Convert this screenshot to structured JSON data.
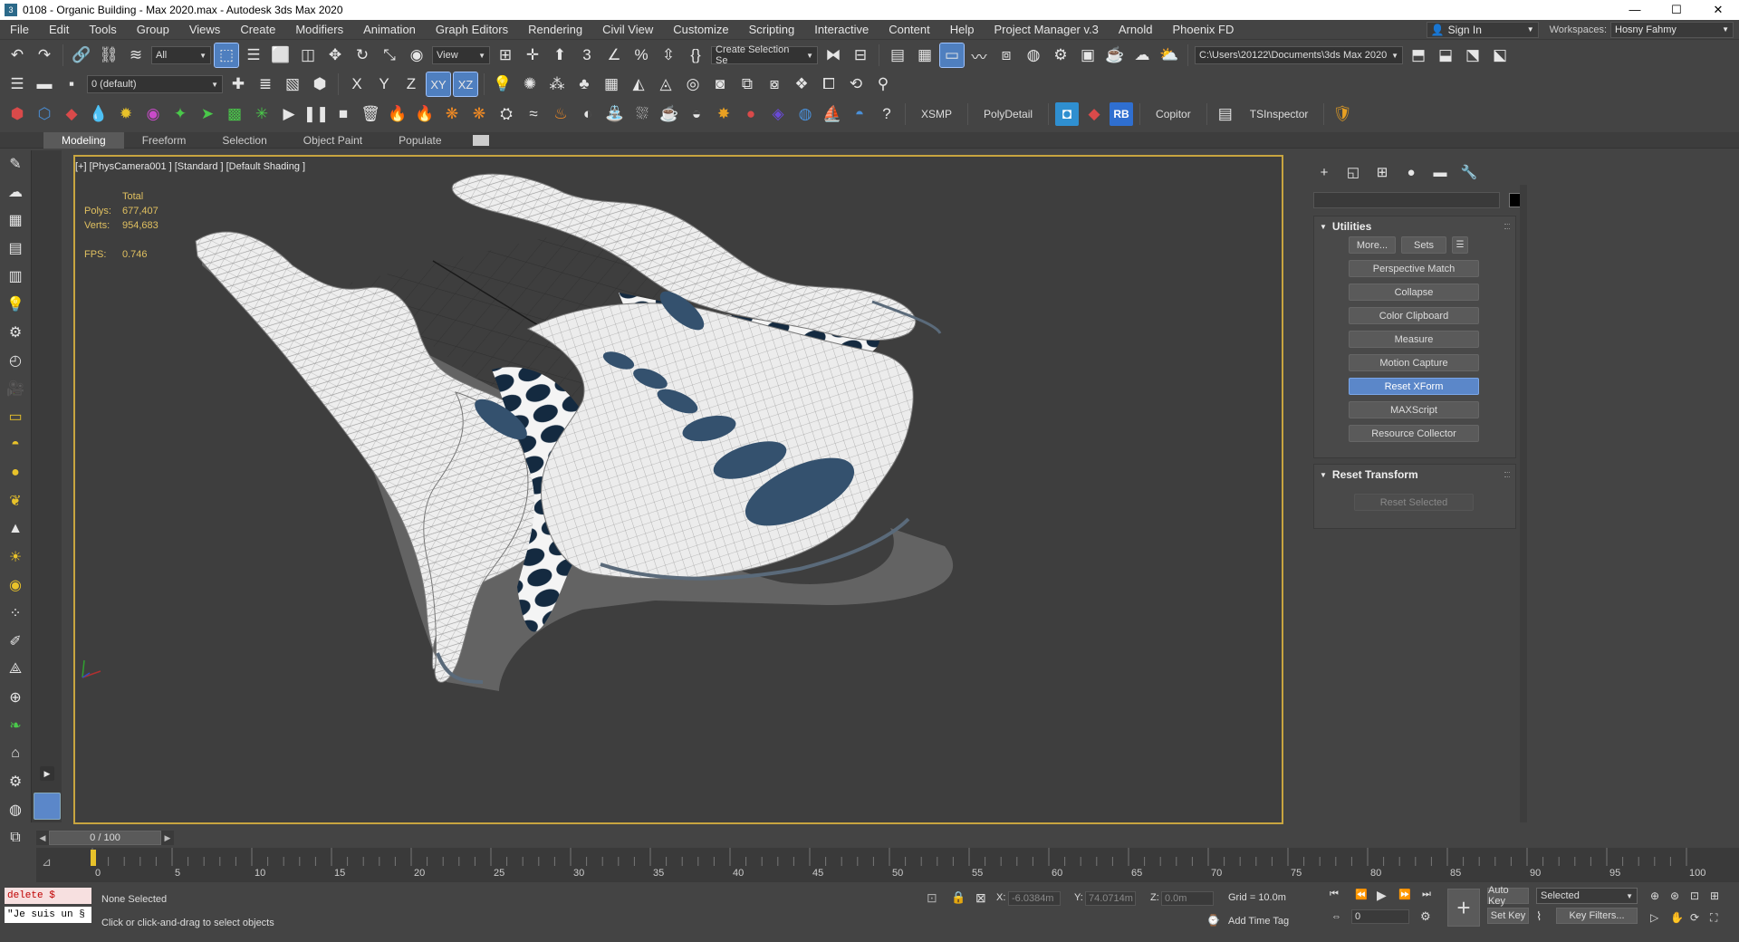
{
  "window": {
    "title": "0108 - Organic Building - Max 2020.max - Autodesk 3ds Max 2020",
    "controls": {
      "minimize": "—",
      "maximize": "☐",
      "close": "✕"
    }
  },
  "menu": [
    "File",
    "Edit",
    "Tools",
    "Group",
    "Views",
    "Create",
    "Modifiers",
    "Animation",
    "Graph Editors",
    "Rendering",
    "Civil View",
    "Customize",
    "Scripting",
    "Interactive",
    "Content",
    "Help",
    "Project Manager v.3",
    "Arnold",
    "Phoenix FD"
  ],
  "account": {
    "sign_in": "Sign In",
    "workspaces_label": "Workspaces:",
    "workspace": "Hosny Fahmy"
  },
  "toolbar1": {
    "selection_filter": "All",
    "ref_coord": "View",
    "named_selection": "Create Selection Se",
    "project_path": "C:\\Users\\20122\\Documents\\3ds Max 2020"
  },
  "toolbar2": {
    "layer": "0 (default)",
    "axis": {
      "x": "X",
      "y": "Y",
      "z": "Z",
      "xy": "XY",
      "xz": "XZ"
    }
  },
  "toolbar3": {
    "xsmp": "XSMP",
    "polydetail": "PolyDetail",
    "rb": "RB",
    "copitor": "Copitor",
    "tsinspector": "TSInspector"
  },
  "ribbon": {
    "tabs": [
      "Modeling",
      "Freeform",
      "Selection",
      "Object Paint",
      "Populate"
    ],
    "active": "Modeling"
  },
  "viewport": {
    "label": "[+] [PhysCamera001 ] [Standard ] [Default Shading ]",
    "stats": {
      "header": "Total",
      "polys_label": "Polys:",
      "polys": "677,407",
      "verts_label": "Verts:",
      "verts": "954,683",
      "fps_label": "FPS:",
      "fps": "0.746"
    }
  },
  "command_panel": {
    "utilities": {
      "title": "Utilities",
      "more": "More...",
      "sets": "Sets",
      "buttons": [
        "Perspective Match",
        "Collapse",
        "Color Clipboard",
        "Measure",
        "Motion Capture",
        "Reset XForm",
        "MAXScript",
        "Resource Collector"
      ],
      "active_button": "Reset XForm"
    },
    "reset_transform": {
      "title": "Reset Transform",
      "reset_selected": "Reset Selected"
    }
  },
  "timeline": {
    "frame": "0 / 100",
    "ticks": [
      "0",
      "5",
      "10",
      "15",
      "20",
      "25",
      "30",
      "35",
      "40",
      "45",
      "50",
      "55",
      "60",
      "65",
      "70",
      "75",
      "80",
      "85",
      "90",
      "95",
      "100"
    ]
  },
  "status": {
    "maxscript_line1": "delete $",
    "maxscript_line2": "\"Je suis un §",
    "selection": "None Selected",
    "prompt": "Click or click-and-drag to select objects",
    "x_label": "X:",
    "x": "-6.0384m",
    "y_label": "Y:",
    "y": "74.0714m",
    "z_label": "Z:",
    "z": "0.0m",
    "grid": "Grid = 10.0m",
    "add_time_tag": "Add Time Tag",
    "auto_key": "Auto Key",
    "set_key": "Set Key",
    "key_mode": "Selected",
    "key_filters": "Key Filters...",
    "current_frame": "0"
  }
}
